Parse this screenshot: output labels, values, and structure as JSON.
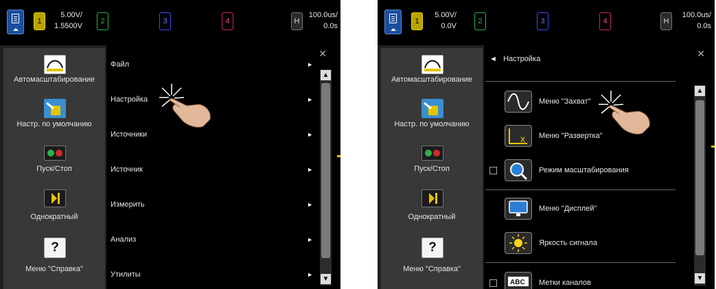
{
  "left": {
    "topbar": {
      "ch1": "1",
      "ch2": "2",
      "ch3": "3",
      "ch4": "4",
      "volts_div": "5.00V/",
      "offset": "1.5500V",
      "h_button": "H",
      "time_div": "100.0us/",
      "delay": "0.0s"
    },
    "sidebar": {
      "autoscale": "Автомасштабирование",
      "default_setup": "Настр. по умолчанию",
      "run_stop": "Пуск/Стоп",
      "single": "Однократный",
      "help": "Меню \"Справка\"",
      "help_glyph": "?"
    },
    "menu": {
      "items": [
        {
          "label": "Файл",
          "arrow": "►"
        },
        {
          "label": "Настройка",
          "arrow": "►"
        },
        {
          "label": "Источники",
          "arrow": "►"
        },
        {
          "label": "Источник",
          "arrow": "►"
        },
        {
          "label": "Измерить",
          "arrow": "►"
        },
        {
          "label": "Анализ",
          "arrow": "►"
        },
        {
          "label": "Утилиты",
          "arrow": "►"
        }
      ],
      "close": "✕"
    }
  },
  "right": {
    "topbar": {
      "ch1": "1",
      "ch2": "2",
      "ch3": "3",
      "ch4": "4",
      "volts_div": "5.00V/",
      "offset": "0.0V",
      "h_button": "H",
      "time_div": "100.0us/",
      "delay": "0.0s"
    },
    "sidebar": {
      "autoscale": "Автомасштабирование",
      "default_setup": "Настр. по умолчанию",
      "run_stop": "Пуск/Стоп",
      "single": "Однократный",
      "help": "Меню \"Справка\"",
      "help_glyph": "?"
    },
    "submenu": {
      "back_arrow": "◄",
      "title": "Настройка",
      "close": "✕",
      "items": [
        {
          "label": "Меню \"Захват\"",
          "icon": "sine-wave-icon"
        },
        {
          "label": "Меню \"Развертка\"",
          "icon": "horizontal-axis-icon"
        },
        {
          "label": "Режим масштабирования",
          "icon": "magnifier-icon"
        },
        {
          "label": "Меню \"Дисплей\"",
          "icon": "monitor-icon"
        },
        {
          "label": "Яркость сигнала",
          "icon": "sun-icon"
        },
        {
          "label": "Метки каналов",
          "icon": "abc-label-icon",
          "icon_text": "ABC"
        }
      ]
    }
  },
  "colors": {
    "channel1": "#e5d200",
    "channel2": "#2fb24a",
    "channel3": "#3b4cff",
    "channel4": "#d0206a",
    "menu_button": "#1a4fa0"
  }
}
